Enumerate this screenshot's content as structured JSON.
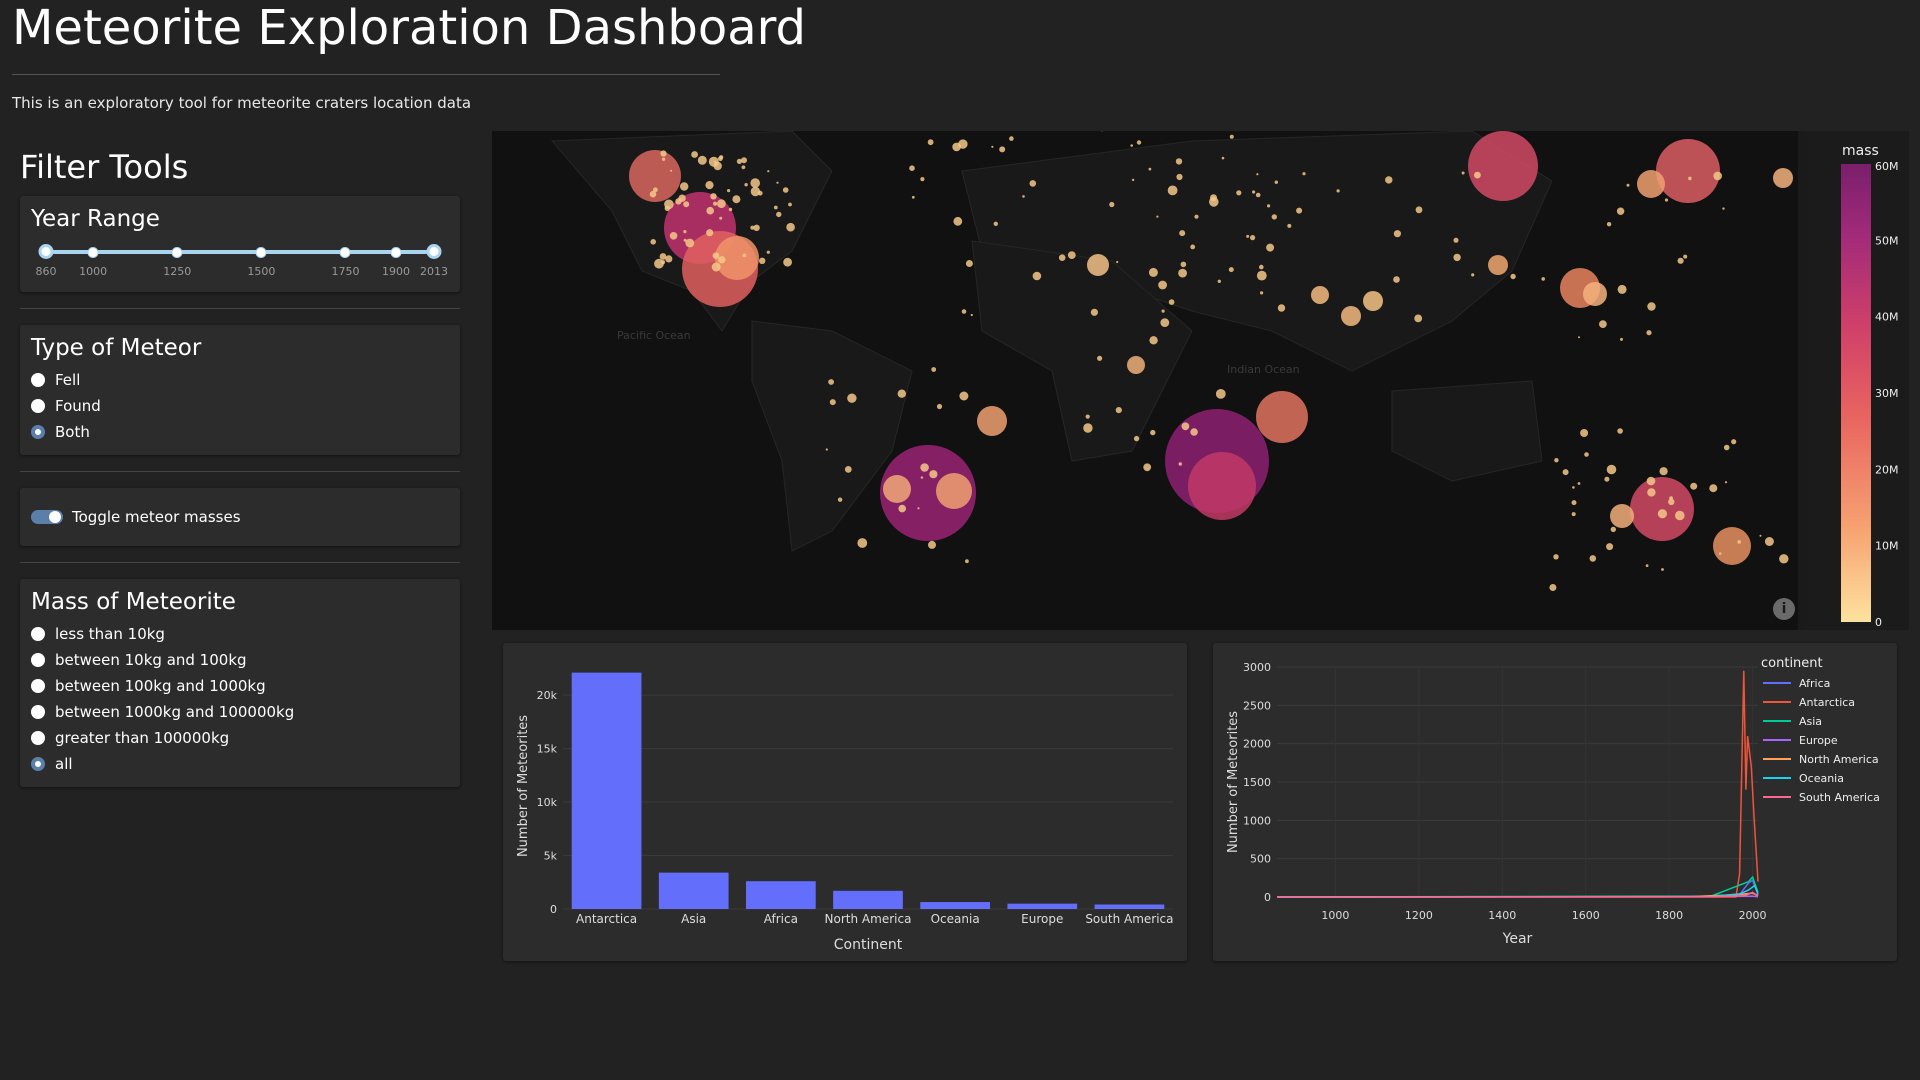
{
  "header": {
    "title": "Meteorite Exploration Dashboard",
    "subtitle": "This is an exploratory tool for meteorite craters location data"
  },
  "filters": {
    "title": "Filter Tools",
    "year_range": {
      "label": "Year Range",
      "marks": [
        "860",
        "1000",
        "1250",
        "1500",
        "1750",
        "1900",
        "2013"
      ],
      "min": 860,
      "max": 2013,
      "selected": [
        860,
        2013
      ]
    },
    "meteor_type": {
      "label": "Type of Meteor",
      "options": [
        "Fell",
        "Found",
        "Both"
      ],
      "selected": "Both"
    },
    "toggle": {
      "label": "Toggle meteor masses",
      "on": true
    },
    "mass": {
      "label": "Mass of Meteorite",
      "options": [
        "less than 10kg",
        "between 10kg and 100kg",
        "between 100kg and 1000kg",
        "between 1000kg and 100000kg",
        "greater than 100000kg",
        "all"
      ],
      "selected": "all"
    }
  },
  "map": {
    "colorbar": {
      "title": "mass",
      "ticks": [
        "60M",
        "50M",
        "40M",
        "30M",
        "20M",
        "10M",
        "0"
      ],
      "colors": [
        "#fde2a0",
        "#f7a372",
        "#e8645f",
        "#cf3f6a",
        "#a02a79",
        "#7a1f6b"
      ]
    },
    "ocean_labels": [
      "Pacific Ocean",
      "Indian Ocean"
    ],
    "info_icon": "info-icon"
  },
  "chart_data": [
    {
      "type": "bar",
      "categories": [
        "Antarctica",
        "Asia",
        "Africa",
        "North America",
        "Oceania",
        "Europe",
        "South America"
      ],
      "values": [
        22100,
        3400,
        2600,
        1700,
        650,
        500,
        420
      ],
      "xlabel": "Continent",
      "ylabel": "Number of Meteorites",
      "ylim": [
        0,
        23000
      ],
      "yticks": [
        0,
        5000,
        10000,
        15000,
        20000
      ],
      "ytick_labels": [
        "0",
        "5k",
        "10k",
        "15k",
        "20k"
      ],
      "color": "#636efa"
    },
    {
      "type": "line",
      "xlabel": "Year",
      "ylabel": "Number of Meteorites",
      "xlim": [
        860,
        2013
      ],
      "ylim": [
        0,
        3000
      ],
      "xticks": [
        1000,
        1200,
        1400,
        1600,
        1800,
        2000
      ],
      "yticks": [
        0,
        500,
        1000,
        1500,
        2000,
        2500,
        3000
      ],
      "legend_title": "continent",
      "legend_placement": "top-right",
      "series": [
        {
          "name": "Africa",
          "color": "#636efa",
          "points": [
            [
              860,
              0
            ],
            [
              1900,
              5
            ],
            [
              1970,
              40
            ],
            [
              1990,
              180
            ],
            [
              2000,
              220
            ],
            [
              2013,
              30
            ]
          ]
        },
        {
          "name": "Antarctica",
          "color": "#ef553b",
          "points": [
            [
              860,
              0
            ],
            [
              1960,
              0
            ],
            [
              1969,
              300
            ],
            [
              1979,
              2950
            ],
            [
              1984,
              1400
            ],
            [
              1988,
              2100
            ],
            [
              1997,
              1700
            ],
            [
              2003,
              1100
            ],
            [
              2013,
              200
            ]
          ]
        },
        {
          "name": "Asia",
          "color": "#00cc96",
          "points": [
            [
              860,
              0
            ],
            [
              1900,
              10
            ],
            [
              1990,
              200
            ],
            [
              2000,
              260
            ],
            [
              2013,
              60
            ]
          ]
        },
        {
          "name": "Europe",
          "color": "#ab63fa",
          "points": [
            [
              860,
              1
            ],
            [
              1800,
              3
            ],
            [
              1900,
              8
            ],
            [
              2000,
              12
            ],
            [
              2013,
              3
            ]
          ]
        },
        {
          "name": "North America",
          "color": "#ffa15a",
          "points": [
            [
              860,
              0
            ],
            [
              1850,
              5
            ],
            [
              1900,
              15
            ],
            [
              1960,
              30
            ],
            [
              2000,
              50
            ],
            [
              2013,
              20
            ]
          ]
        },
        {
          "name": "Oceania",
          "color": "#19d3f3",
          "points": [
            [
              860,
              0
            ],
            [
              1900,
              5
            ],
            [
              1970,
              40
            ],
            [
              1990,
              90
            ],
            [
              2005,
              150
            ],
            [
              2013,
              40
            ]
          ]
        },
        {
          "name": "South America",
          "color": "#ff6692",
          "points": [
            [
              860,
              0
            ],
            [
              1900,
              3
            ],
            [
              1980,
              15
            ],
            [
              2000,
              60
            ],
            [
              2013,
              10
            ]
          ]
        }
      ]
    }
  ]
}
